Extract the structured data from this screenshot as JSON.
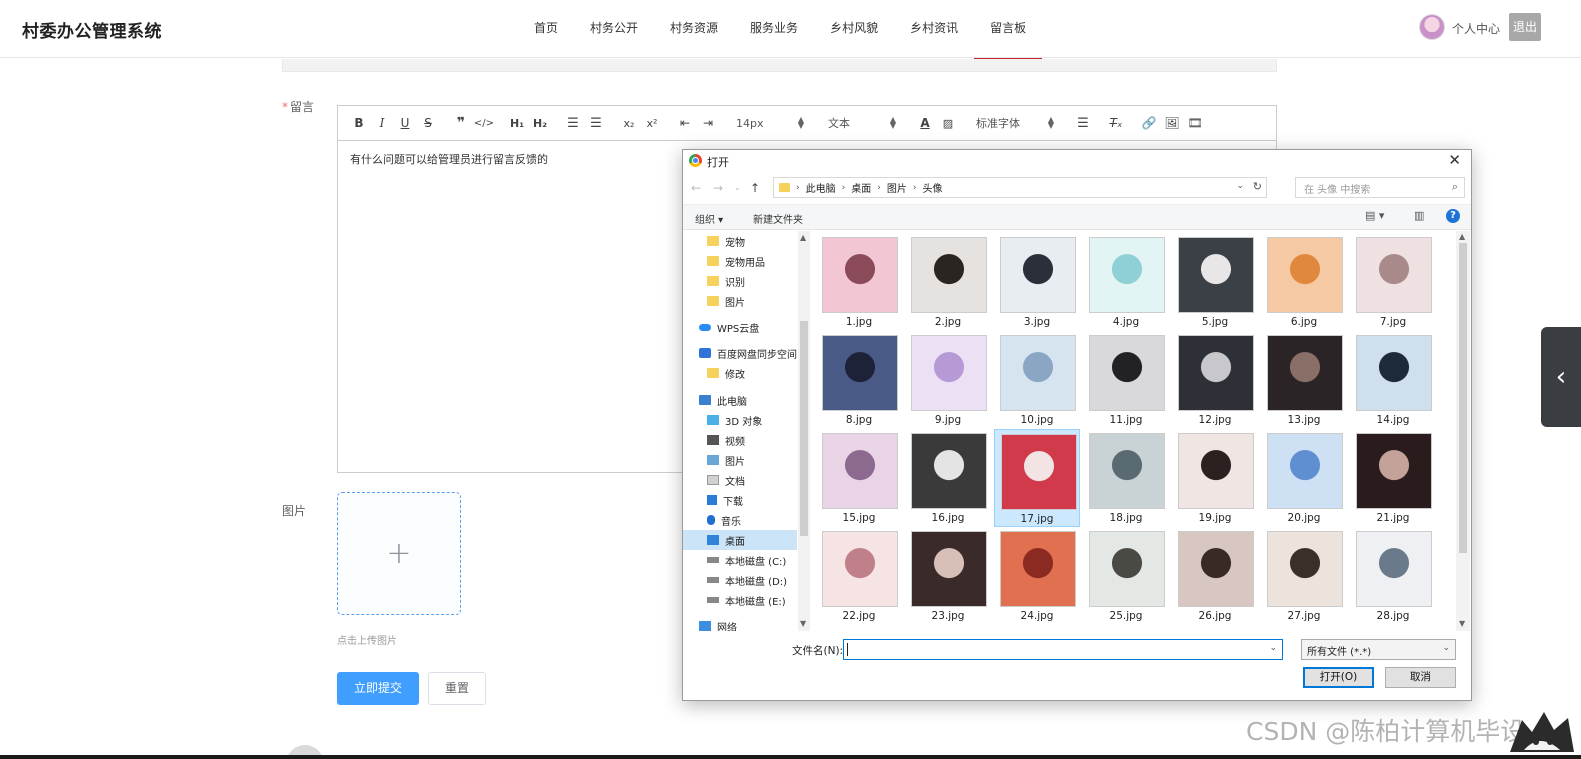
{
  "app": {
    "title": "村委办公管理系统",
    "nav": [
      "首页",
      "村务公开",
      "村务资源",
      "服务业务",
      "乡村风貌",
      "乡村资讯",
      "留言板"
    ],
    "active_nav_index": 6,
    "user_center": "个人中心",
    "logout": "退出"
  },
  "form": {
    "message_label": "留言",
    "required_mark": "*",
    "toolbar": {
      "font_size": "14px",
      "block_type": "文本",
      "font_family": "标准字体"
    },
    "editor_text": "有什么问题可以给管理员进行留言反馈的",
    "image_label": "图片",
    "upload_plus": "+",
    "upload_tip": "点击上传图片",
    "submit": "立即提交",
    "reset": "重置"
  },
  "dialog": {
    "title": "打开",
    "close": "✕",
    "breadcrumb": [
      "此电脑",
      "桌面",
      "图片",
      "头像"
    ],
    "search_placeholder": "在 头像 中搜索",
    "organize": "组织 ▾",
    "new_folder": "新建文件夹",
    "tree": [
      {
        "label": "宠物",
        "icon": "folder-icon"
      },
      {
        "label": "宠物用品",
        "icon": "folder-icon"
      },
      {
        "label": "识别",
        "icon": "folder-icon"
      },
      {
        "label": "图片",
        "icon": "folder-icon"
      },
      {
        "label": "WPS云盘",
        "icon": "cloud-icon"
      },
      {
        "label": "百度网盘同步空间",
        "icon": "baidu-icon"
      },
      {
        "label": "修改",
        "icon": "folder-icon"
      },
      {
        "label": "此电脑",
        "icon": "pc-icon"
      },
      {
        "label": "3D 对象",
        "icon": "3d-icon"
      },
      {
        "label": "视频",
        "icon": "video-icon"
      },
      {
        "label": "图片",
        "icon": "pictures-icon"
      },
      {
        "label": "文档",
        "icon": "documents-icon"
      },
      {
        "label": "下载",
        "icon": "download-icon"
      },
      {
        "label": "音乐",
        "icon": "music-icon"
      },
      {
        "label": "桌面",
        "icon": "desktop-icon",
        "selected": true
      },
      {
        "label": "本地磁盘 (C:)",
        "icon": "disk-icon"
      },
      {
        "label": "本地磁盘 (D:)",
        "icon": "disk-icon"
      },
      {
        "label": "本地磁盘 (E:)",
        "icon": "disk-icon"
      },
      {
        "label": "网络",
        "icon": "network-icon"
      }
    ],
    "files": [
      "1.jpg",
      "2.jpg",
      "3.jpg",
      "4.jpg",
      "5.jpg",
      "6.jpg",
      "7.jpg",
      "8.jpg",
      "9.jpg",
      "10.jpg",
      "11.jpg",
      "12.jpg",
      "13.jpg",
      "14.jpg",
      "15.jpg",
      "16.jpg",
      "17.jpg",
      "18.jpg",
      "19.jpg",
      "20.jpg",
      "21.jpg",
      "22.jpg",
      "23.jpg",
      "24.jpg",
      "25.jpg",
      "26.jpg",
      "27.jpg",
      "28.jpg"
    ],
    "selected_file": "17.jpg",
    "filename_label": "文件名(N):",
    "filename_value": "",
    "filetype": "所有文件 (*.*)",
    "open_button": "打开(O)",
    "cancel_button": "取消"
  },
  "watermark": "CSDN @陈柏计算机毕设",
  "colors": {
    "nav_active": "#c9242a",
    "primary_button": "#409eff",
    "dialog_accent": "#0078d7",
    "tree_selected": "#cce4f7"
  }
}
